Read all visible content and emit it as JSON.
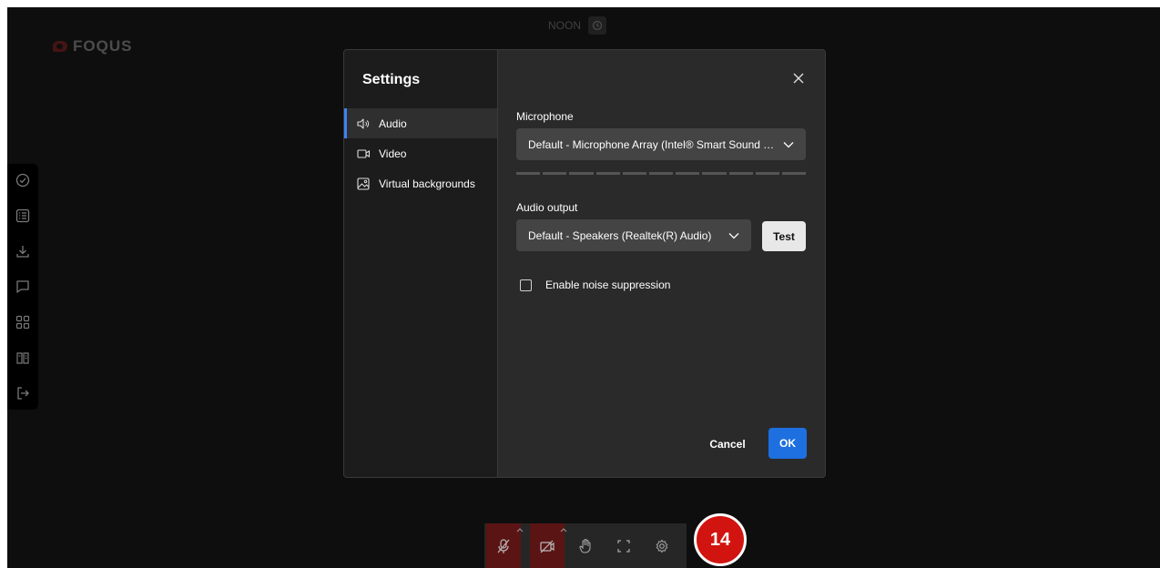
{
  "app": {
    "logo_text": "FOQUS",
    "session_label": "NOON"
  },
  "side_toolbar": {
    "icons": [
      "check-circle-icon",
      "list-icon",
      "download-icon",
      "chat-icon",
      "grid-icon",
      "book-icon",
      "exit-icon"
    ]
  },
  "settings": {
    "title": "Settings",
    "nav": [
      {
        "label": "Audio",
        "icon": "speaker-icon",
        "active": true
      },
      {
        "label": "Video",
        "icon": "video-icon",
        "active": false
      },
      {
        "label": "Virtual backgrounds",
        "icon": "image-icon",
        "active": false
      }
    ],
    "microphone_label": "Microphone",
    "microphone_value": "Default - Microphone Array (Intel® Smart Sound Technology for Digital Microphones)",
    "audio_output_label": "Audio output",
    "audio_output_value": "Default - Speakers (Realtek(R) Audio)",
    "test_label": "Test",
    "noise_suppression_label": "Enable noise suppression",
    "noise_suppression_checked": false,
    "cancel_label": "Cancel",
    "ok_label": "OK"
  },
  "bottom_bar": {
    "buttons": [
      "mic-muted-icon",
      "camera-off-icon",
      "raise-hand-icon",
      "fullscreen-icon",
      "settings-icon"
    ]
  },
  "step_badge": "14",
  "colors": {
    "accent": "#1e6fe0",
    "danger": "#d1140f",
    "muted_red": "#5a1414"
  }
}
